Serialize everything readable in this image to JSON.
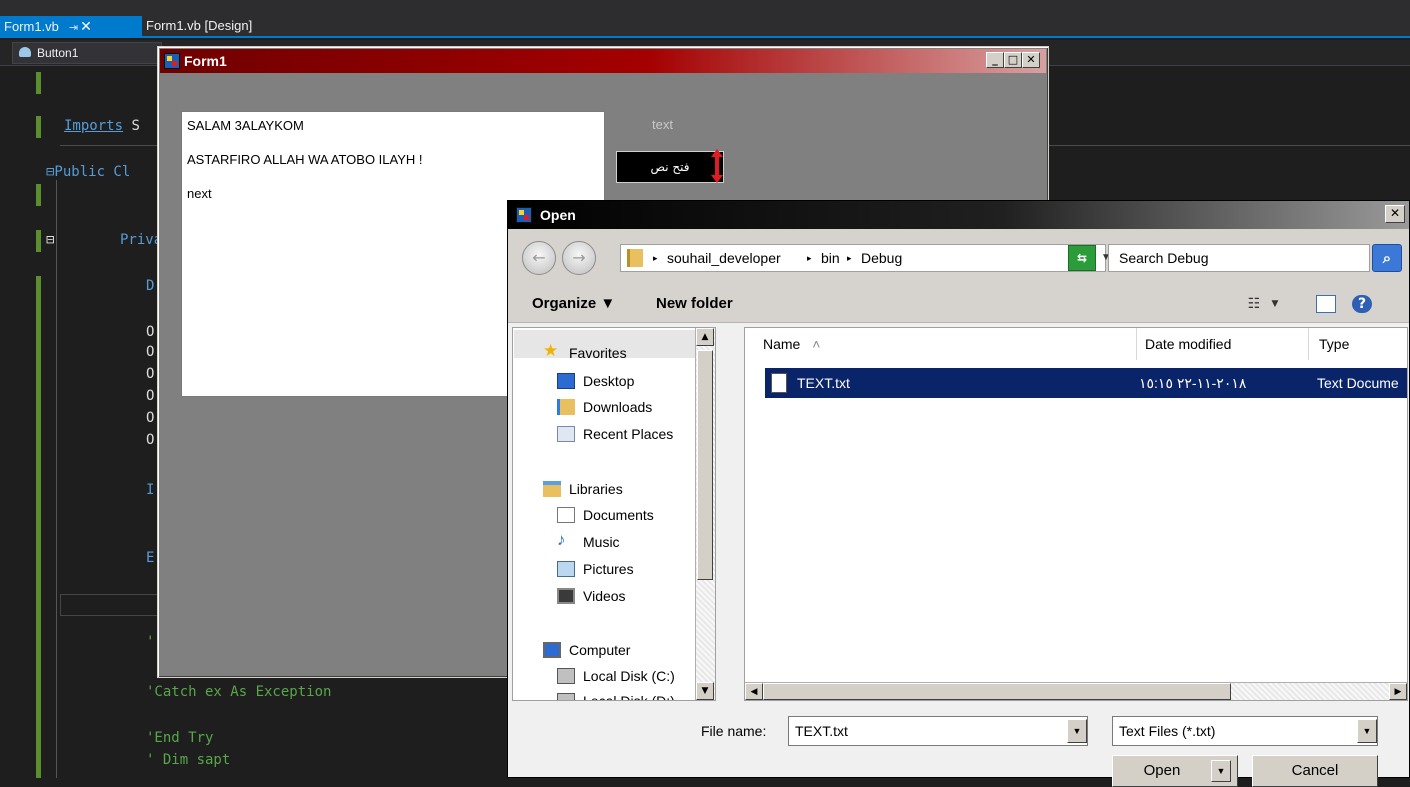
{
  "ide": {
    "tabs": [
      {
        "label": "Form1.vb",
        "pin": "⇥",
        "close": "✕"
      },
      {
        "label": "Form1.vb [Design]"
      }
    ],
    "nav_combo": "Button1",
    "code_lines": {
      "imports": {
        "kw": "Imports",
        "rest": " S"
      },
      "public_class": "⊟Public Cl",
      "private": "Priva",
      "collapse_glyph": "⊟",
      "d": "D",
      "o1": "O",
      "o2": "O",
      "o3": "O",
      "o4": "O",
      "o5": "O",
      "o6": "O",
      "i": "I",
      "e": "E",
      "tick": "'",
      "catch": "'Catch ex As Exception",
      "end_try": "'End Try",
      "dim_sapt": "' Dim sapt"
    }
  },
  "form1": {
    "title": "Form1",
    "caption_buttons": [
      "_",
      "□",
      "✕"
    ],
    "textarea_lines": [
      "SALAM 3ALAYKOM",
      "ASTARFIRO ALLAH WA ATOBO ILAYH !",
      "next"
    ],
    "label": "text",
    "button_label": "فتح نص"
  },
  "open_dialog": {
    "title": "Open",
    "close": "✕",
    "back": "←",
    "forward": "→",
    "breadcrumb": [
      "souhail_developer",
      "bin",
      "Debug"
    ],
    "breadcrumb_sep": "▸",
    "search_placeholder": "Search Debug",
    "commands": {
      "organize": "Organize ▼",
      "new_folder": "New folder"
    },
    "nav": {
      "favorites": "Favorites",
      "desktop": "Desktop",
      "downloads": "Downloads",
      "recent": "Recent Places",
      "libraries": "Libraries",
      "documents": "Documents",
      "music": "Music",
      "pictures": "Pictures",
      "videos": "Videos",
      "computer": "Computer",
      "local_c": "Local Disk (C:)",
      "local_d": "Local Disk (D:)"
    },
    "columns": {
      "name": "Name",
      "sort": "˄",
      "date": "Date modified",
      "type": "Type"
    },
    "files": [
      {
        "name": "TEXT.txt",
        "date": "٢٠١٨-١١-٢٢ ١٥:١٥",
        "type": "Text Docume"
      }
    ],
    "file_name_label": "File name:",
    "file_name_value": "TEXT.txt",
    "filter": "Text Files (*.txt)",
    "open_label": "Open",
    "cancel_label": "Cancel",
    "arrow_down": "▼",
    "arrow_up": "▲",
    "arrow_left": "◀",
    "arrow_right": "▶"
  }
}
